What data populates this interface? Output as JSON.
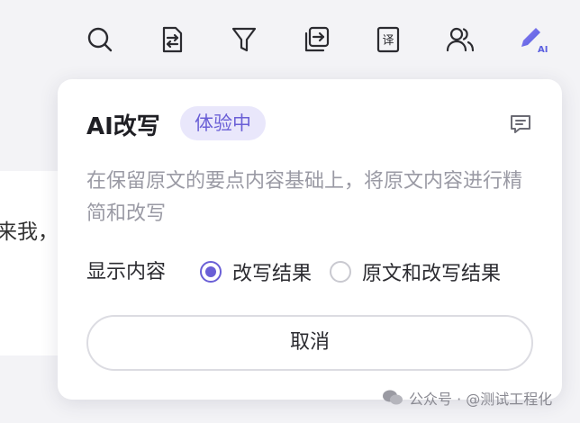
{
  "toolbar": {
    "icons": [
      "search-icon",
      "document-format-icon",
      "filter-icon",
      "export-icon",
      "translate-icon",
      "users-icon",
      "ai-rewrite-icon"
    ],
    "accent": "#6a5fd6"
  },
  "background": {
    "doc_text": "来我，/"
  },
  "popup": {
    "title": "AI改写",
    "badge": "体验中",
    "description": "在保留原文的要点内容基础上，将原文内容进行精简和改写",
    "display_label": "显示内容",
    "options": [
      {
        "label": "改写结果",
        "selected": true
      },
      {
        "label": "原文和改写结果",
        "selected": false
      }
    ],
    "cancel_label": "取消"
  },
  "watermark": {
    "text": "公众号 · @测试工程化"
  },
  "colors": {
    "accent": "#6a5fd6",
    "badge_bg": "#e9e7fb",
    "muted_text": "#9a9aa4"
  }
}
